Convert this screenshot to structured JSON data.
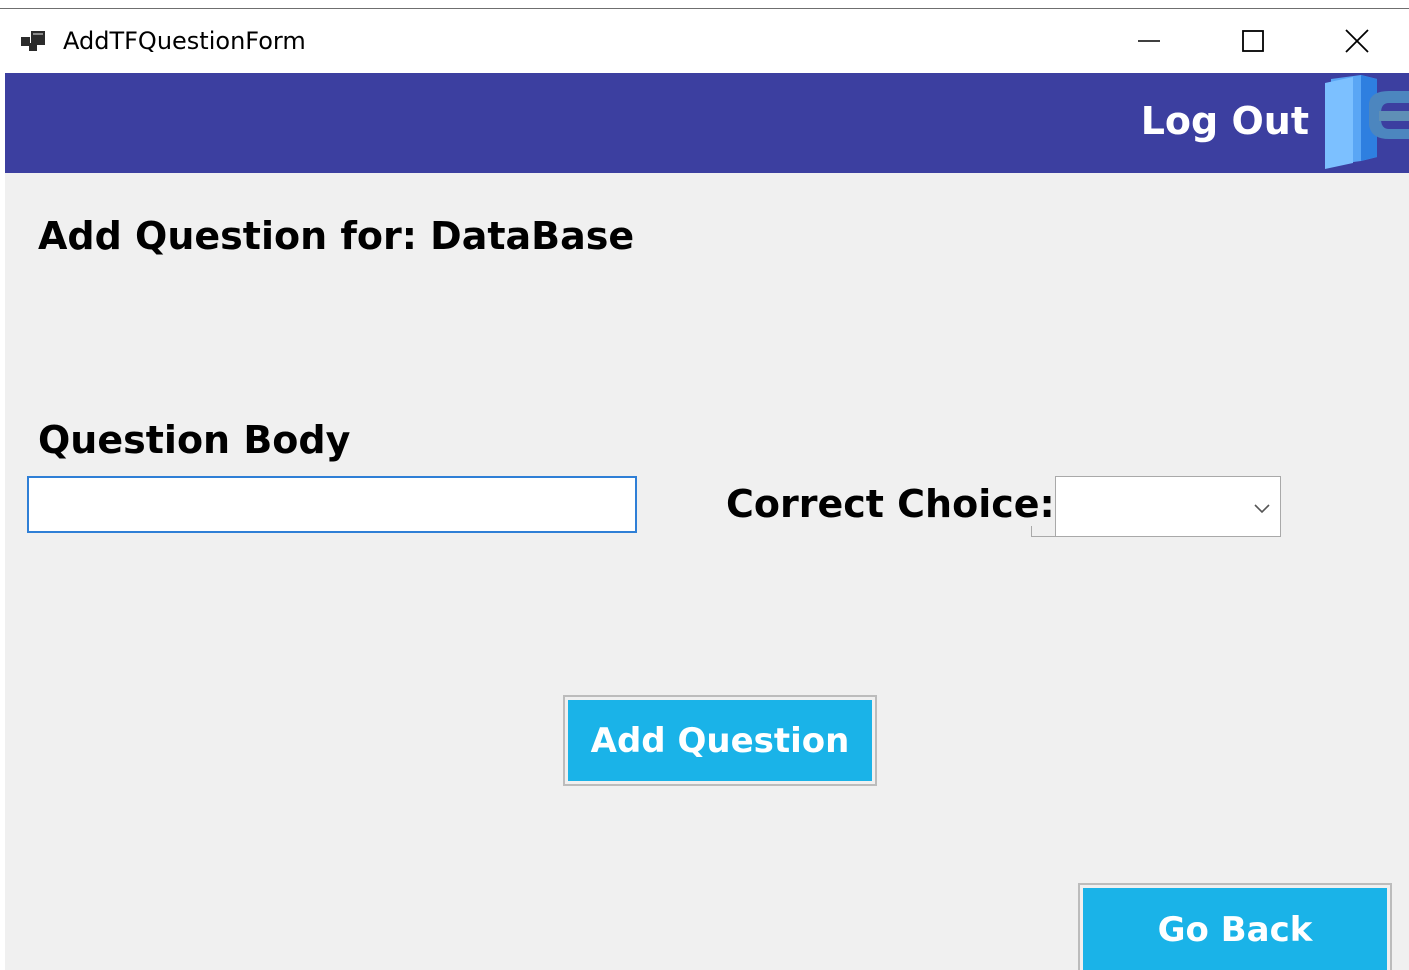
{
  "window": {
    "title": "AddTFQuestionForm",
    "controls": {
      "minimize": "minimize-icon",
      "maximize": "maximize-icon",
      "close": "close-icon"
    }
  },
  "header": {
    "logout_label": "Log Out",
    "logout_icon": "door-exit-icon",
    "background": "#3c3fa0"
  },
  "main": {
    "heading": "Add Question for: DataBase",
    "question_body_label": "Question Body",
    "question_body_value": "",
    "correct_choice_label": "Correct Choice:",
    "correct_choice_value": "",
    "add_question_label": "Add Question",
    "go_back_label": "Go Back",
    "button_color": "#1ab3e8"
  }
}
